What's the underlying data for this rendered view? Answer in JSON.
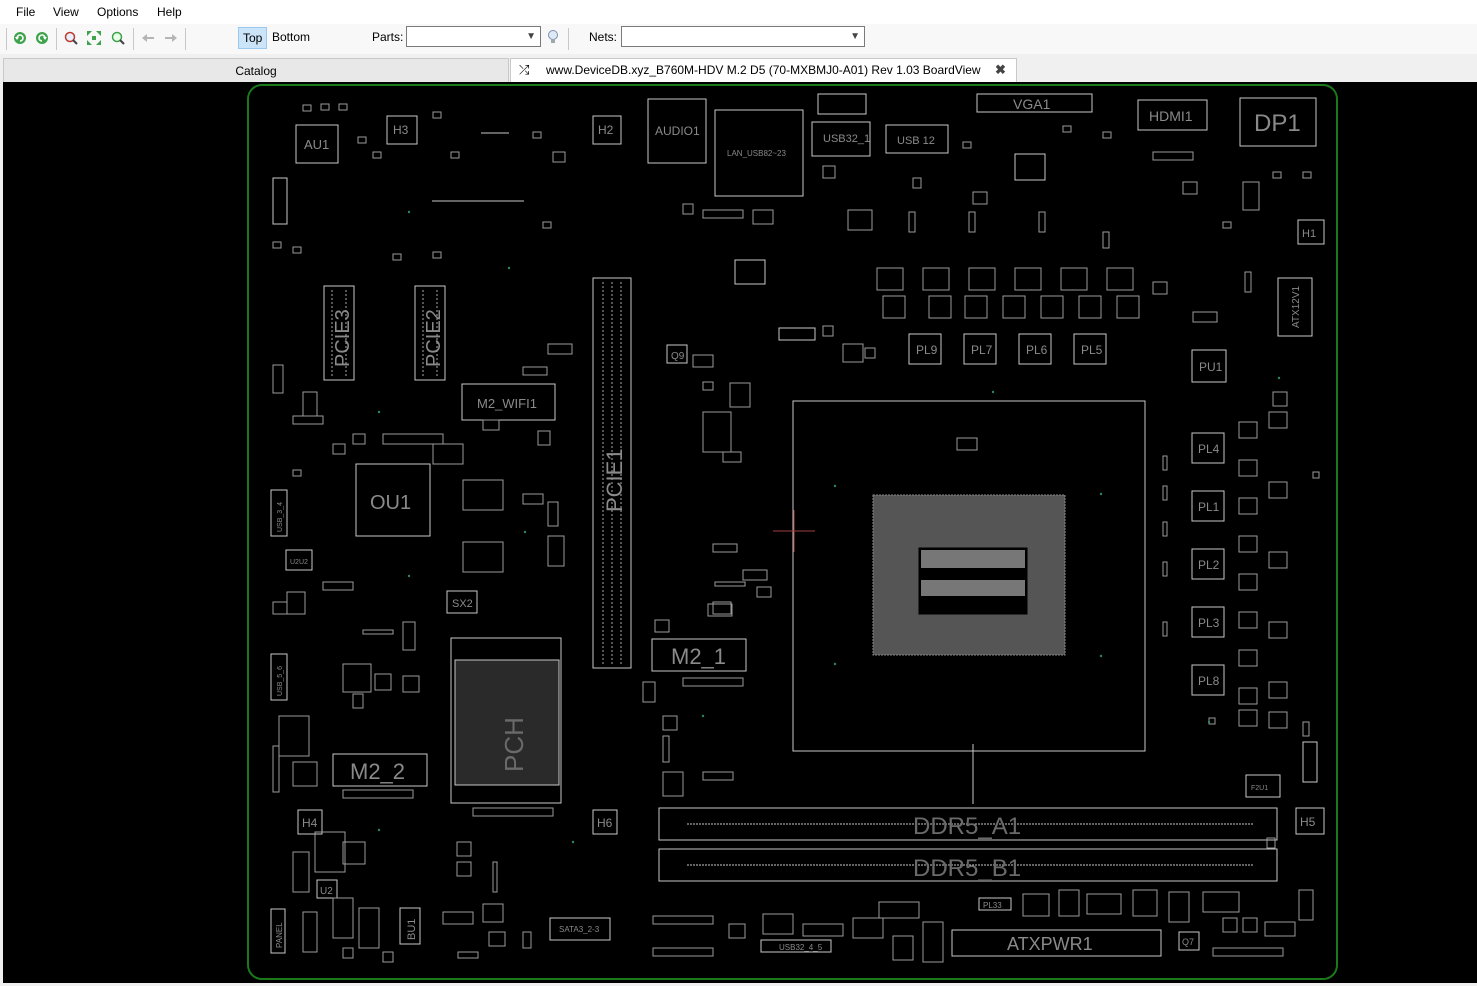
{
  "menu": {
    "file": "File",
    "view": "View",
    "options": "Options",
    "help": "Help"
  },
  "toolbar": {
    "top_label": "Top",
    "bottom_label": "Bottom",
    "parts_label": "Parts:",
    "parts_value": "",
    "nets_label": "Nets:",
    "nets_value": "",
    "icons": [
      "rotate-left-icon",
      "rotate-right-icon",
      "zoom-in-icon",
      "fit-icon",
      "zoom-out-icon",
      "back-arrow-icon",
      "forward-arrow-icon",
      "bulb-icon"
    ]
  },
  "tabs": {
    "catalog": "Catalog",
    "board": "www.DeviceDB.xyz_B760M-HDV M.2 D5 (70-MXBMJ0-A01) Rev 1.03 BoardView"
  },
  "colors": {
    "board_outline": "#1a7a1a",
    "silkscreen": "#c8c8c8",
    "label": "#8a8a8a",
    "cursor": "#a04040"
  },
  "board": {
    "labels": {
      "au1": "AU1",
      "h3": "H3",
      "h2": "H2",
      "audio1": "AUDIO1",
      "lan_usb": "LAN_USB82~23",
      "usb32_1": "USB32_1",
      "usb12": "USB 12",
      "vga1": "VGA1",
      "hdmi1": "HDMI1",
      "dp1": "DP1",
      "h1": "H1",
      "atx12v1": "ATX12V1",
      "pcie3": "PCIE3",
      "pcie2": "PCIE2",
      "m2_wifi1": "M2_WIFI1",
      "q9": "Q9",
      "pl9": "PL9",
      "pl7": "PL7",
      "pl6": "PL6",
      "pl5": "PL5",
      "pu1": "PU1",
      "ou1": "OU1",
      "pcie1": "PCIE1",
      "pl4": "PL4",
      "pl1": "PL1",
      "pl2": "PL2",
      "pl3": "PL3",
      "pl8": "PL8",
      "sx2": "SX2",
      "m2_1": "M2_1",
      "m2_2": "M2_2",
      "pch": "PCH",
      "h4": "H4",
      "h6": "H6",
      "ddr5_a1": "DDR5_A1",
      "ddr5_b1": "DDR5_B1",
      "h5": "H5",
      "u2": "U2",
      "bu1": "BU1",
      "sata3": "SATA3_2-3",
      "usb32_4": "USB32_4_5",
      "pl33": "PL33",
      "atxpwr1": "ATXPWR1",
      "q7": "Q7",
      "panel": "PANEL",
      "f2u1": "F2U1",
      "u2u2": "U2U2",
      "usb34": "USB_3_4",
      "usb56": "USB_5_6"
    }
  }
}
